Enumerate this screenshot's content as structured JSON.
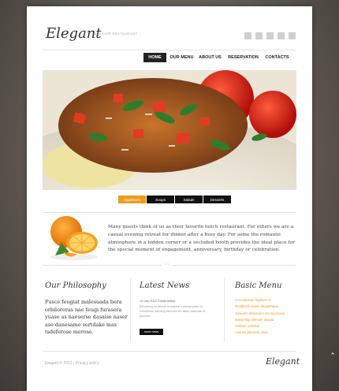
{
  "header": {
    "logo": "Elegant",
    "tagline": "SUPERIOR RESTAURANT",
    "social_icons": [
      "share-icon",
      "twitter-icon",
      "facebook-icon",
      "rss-icon",
      "linkedin-icon"
    ]
  },
  "nav": {
    "items": [
      {
        "label": "HOME",
        "active": true
      },
      {
        "label": "OUR MENU",
        "active": false
      },
      {
        "label": "ABOUT US",
        "active": false
      },
      {
        "label": "RESERVATION",
        "active": false
      },
      {
        "label": "CONTACTS",
        "active": false
      }
    ]
  },
  "tabs": [
    {
      "label": "Appetizers",
      "active": true
    },
    {
      "label": "Soups",
      "active": false
    },
    {
      "label": "Salads",
      "active": false
    },
    {
      "label": "Desserts",
      "active": false
    }
  ],
  "intro": {
    "text": "Many guests think of us as their favorite lunch restaurant. For others we are a casual evening retreat for dinner after a busy day. For some the romantic atmosphere in a hidden corner or a secluded booth provides the ideal place for the special moment of engagement, anniversary, birthday or celebration."
  },
  "philosophy": {
    "title": "Our Philosophy",
    "text": "Fusce feugiat malesuada bera orbiloreras nae feugi furasera yuase as naeserse dasaise naser ase danesame sertdake mas tsdeferose merose."
  },
  "news": {
    "title": "Latest News",
    "date": "15 Jan 2012 Eusanaettae",
    "text": "Elicabeng et ateenl eueassat euneapusme ut rubortlase isevang fasiodet et ratam fasenae et pluaeer.",
    "more_label": "more news"
  },
  "menu": {
    "title": "Basic Menu",
    "items": [
      "Accusantium fugirum et",
      "Reddiseit essem aliquamque",
      "Jurauem bibendum nis lacoresse",
      "Massellag alienum aliquia",
      "Antituur nebalus",
      "Aserias pharetra vitae"
    ]
  },
  "footer": {
    "text": "Elegant © 2012 | Privacy policy",
    "logo": "Elegant"
  },
  "colors": {
    "accent": "#f09a1e",
    "dark": "#111111",
    "background": "#5d574f"
  }
}
